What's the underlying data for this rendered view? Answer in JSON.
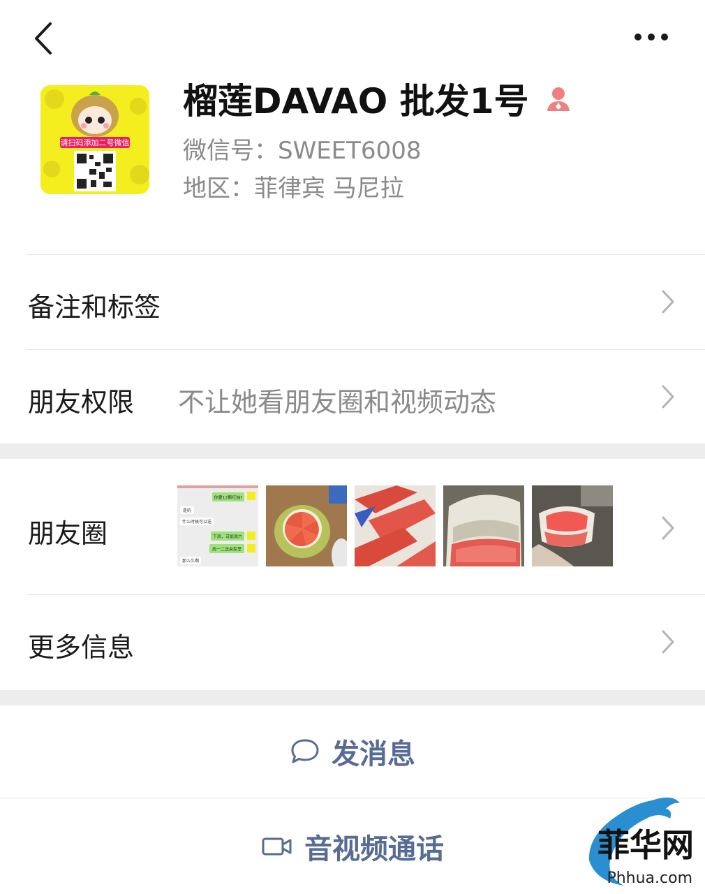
{
  "nav": {
    "back_icon": "chevron-left-icon",
    "more_icon": "more-dots-icon"
  },
  "profile": {
    "name": "榴莲DAVAO 批发1号",
    "gender_icon": "female-icon",
    "wechat_id": "微信号：SWEET6008",
    "region": "地区：菲律宾 马尼拉",
    "avatar_text": "请扫码添加二号微信"
  },
  "rows": {
    "remark": {
      "label": "备注和标签"
    },
    "permission": {
      "label": "朋友权限",
      "value": "不让她看朋友圈和视频动态"
    },
    "moments": {
      "label": "朋友圈",
      "chat_lines": [
        "你要12颗红柚?",
        "是的",
        "什么时候可以送",
        "下周，可能周六",
        "周一二送来家里",
        "那么久啊"
      ]
    },
    "more_info": {
      "label": "更多信息"
    }
  },
  "actions": {
    "message": {
      "label": "发消息",
      "icon": "chat-bubble-icon"
    },
    "call": {
      "label": "音视频通话",
      "icon": "video-camera-icon"
    }
  },
  "watermark": {
    "text": "菲华网",
    "url": "Phhua.com"
  },
  "colors": {
    "link": "#576b95",
    "gap": "#ededed",
    "female": "#f08080"
  }
}
